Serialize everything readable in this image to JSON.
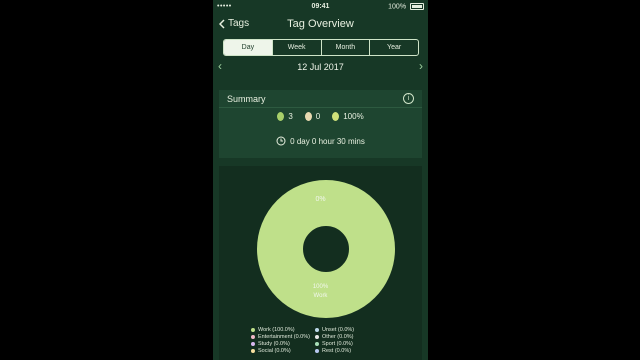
{
  "status": {
    "carrier": "•••••",
    "time": "09:41",
    "battery": "100%"
  },
  "nav": {
    "back": "Tags",
    "title": "Tag Overview"
  },
  "segments": [
    "Day",
    "Week",
    "Month",
    "Year"
  ],
  "date": "12 Jul 2017",
  "summary": {
    "title": "Summary",
    "counts": [
      {
        "value": "3",
        "color": "#a8d06a"
      },
      {
        "value": "0",
        "color": "#e8d9b0"
      },
      {
        "value": "100%",
        "color": "#cfe07a"
      }
    ],
    "duration": "0 day 0 hour 30 mins"
  },
  "chart_data": {
    "type": "pie",
    "labels": [
      "Work",
      "Unset",
      "Entertainment",
      "Other",
      "Study",
      "Sport",
      "Social",
      "Rest"
    ],
    "values": [
      100,
      0,
      0,
      0,
      0,
      0,
      0,
      0
    ],
    "top_label": "0%",
    "main_label": {
      "percent": "100%",
      "name": "Work"
    }
  },
  "legend": [
    {
      "text": "Work (100.0%)",
      "color": "#bfe08a"
    },
    {
      "text": "Unset (0.0%)",
      "color": "#bcd8e8"
    },
    {
      "text": "Entertainment (0.0%)",
      "color": "#f0b8c8"
    },
    {
      "text": "Other (0.0%)",
      "color": "#e8e8e8"
    },
    {
      "text": "Study (0.0%)",
      "color": "#d8b8f0"
    },
    {
      "text": "Sport (0.0%)",
      "color": "#a8e0b8"
    },
    {
      "text": "Social (0.0%)",
      "color": "#f8e0a0"
    },
    {
      "text": "Rest (0.0%)",
      "color": "#b8c8f0"
    }
  ]
}
